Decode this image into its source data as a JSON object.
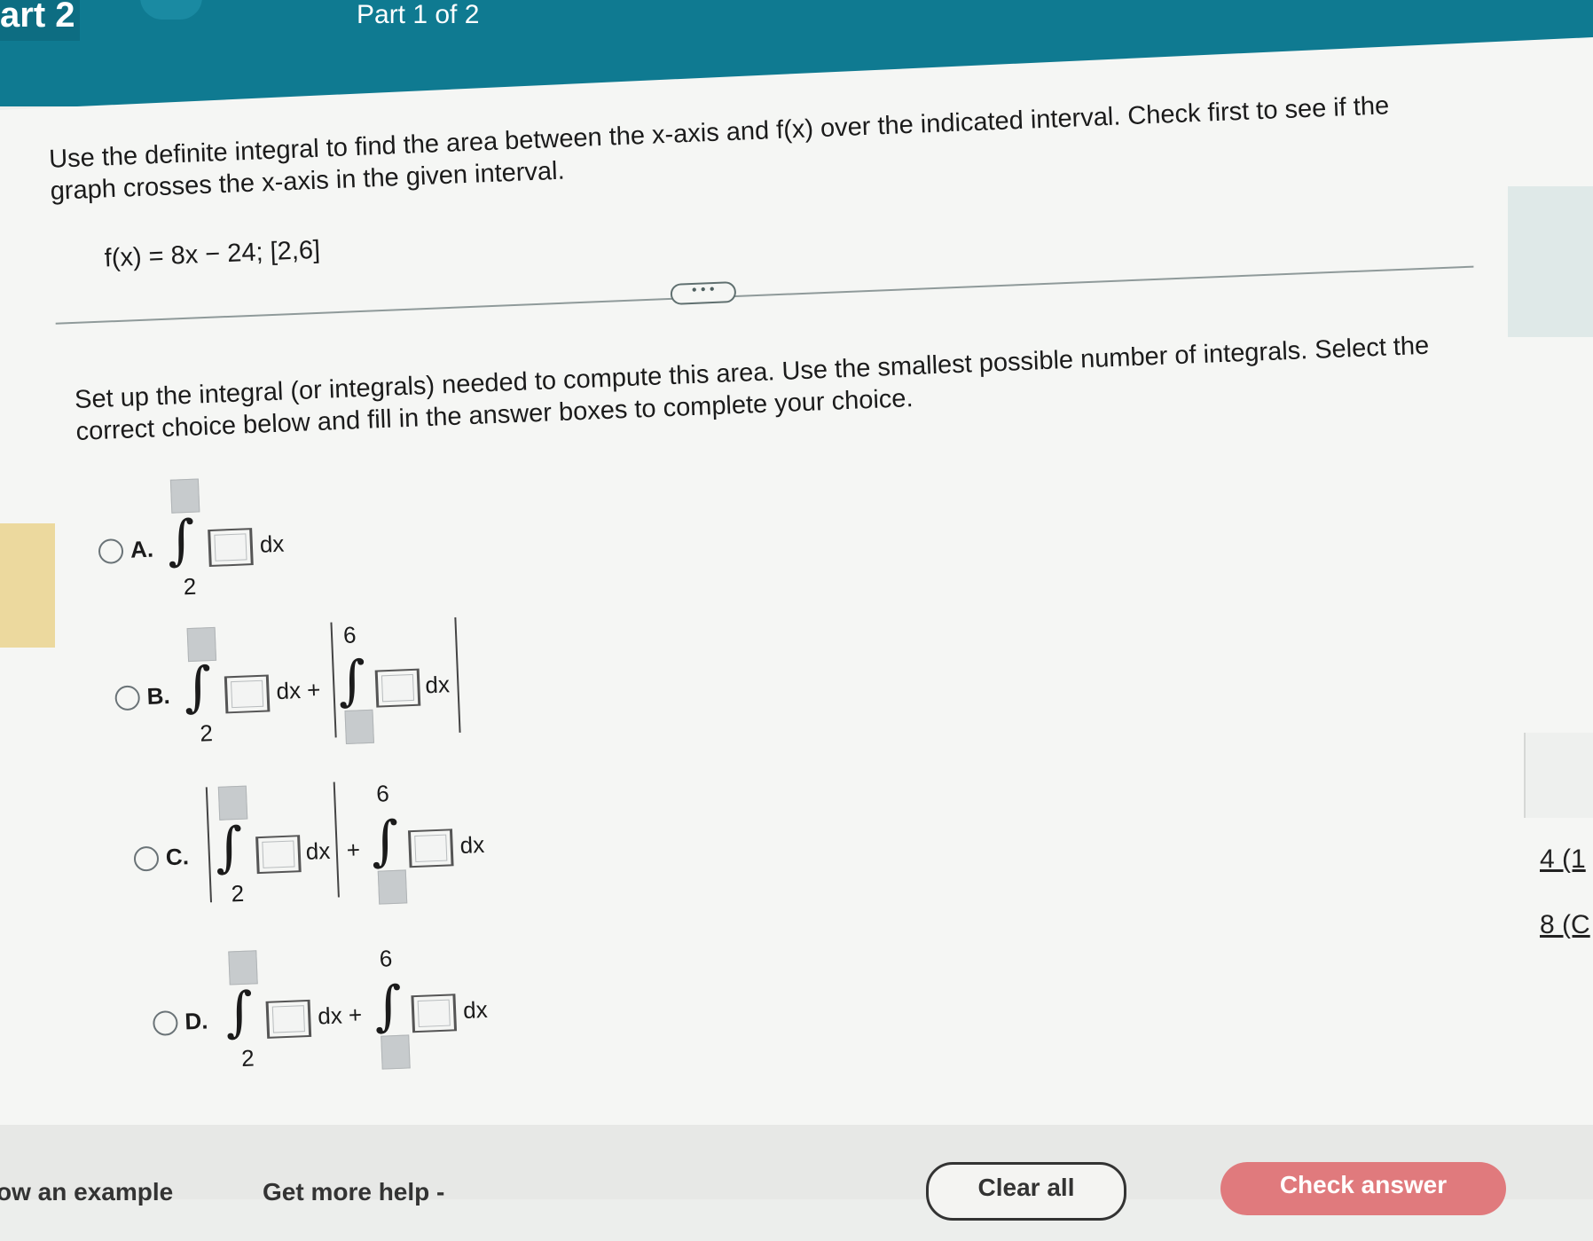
{
  "header": {
    "tab_label": "art 2",
    "part_label": "Part 1 of 2"
  },
  "question": {
    "line1": "Use the definite integral to find the area between the x-axis and f(x) over the indicated interval. Check first to see if the",
    "line2": "graph crosses the x-axis in the given interval.",
    "function": "f(x) = 8x − 24; [2,6]",
    "more_label": "• • •"
  },
  "instructions": {
    "line1": "Set up the integral (or integrals) needed to compute this area. Use the smallest possible number of integrals. Select the",
    "line2": "correct choice below and fill in the answer boxes to complete your choice."
  },
  "choices": [
    {
      "letter": "A.",
      "lower": "2"
    },
    {
      "letter": "B.",
      "lower": "2",
      "upper2": "6",
      "dx_plus": "dx +",
      "dx": "dx"
    },
    {
      "letter": "C.",
      "lower": "2",
      "upper2": "6",
      "dx": "dx",
      "plus": "+",
      "dx2": "dx"
    },
    {
      "letter": "D.",
      "lower": "2",
      "upper2": "6",
      "dx_plus": "dx +",
      "dx": "dx"
    }
  ],
  "integral_symbol": "∫",
  "dx": "dx",
  "side": {
    "link1": "4 (1",
    "link2": "8 (C"
  },
  "footer": {
    "example": "ow an example",
    "help": "Get more help -",
    "clear": "Clear all",
    "check": "Check answer"
  }
}
